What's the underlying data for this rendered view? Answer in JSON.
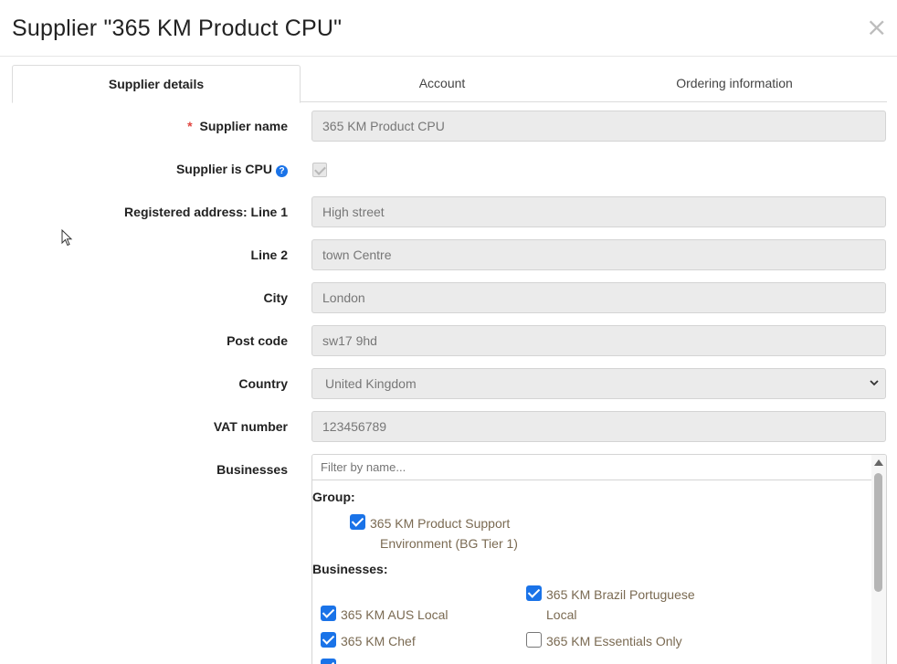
{
  "modal": {
    "title": "Supplier \"365 KM Product CPU\"",
    "close_glyph": "×"
  },
  "tabs": [
    {
      "label": "Supplier details",
      "active": true
    },
    {
      "label": "Account",
      "active": false
    },
    {
      "label": "Ordering information",
      "active": false
    }
  ],
  "form": {
    "supplier_name": {
      "label": "Supplier name",
      "required_mark": "*",
      "value": "365 KM Product CPU"
    },
    "supplier_is_cpu": {
      "label": "Supplier is CPU",
      "help_glyph": "?",
      "checked": true,
      "disabled": true
    },
    "address_line1": {
      "label": "Registered address: Line 1",
      "value": "High street"
    },
    "address_line2": {
      "label": "Line 2",
      "value": "town Centre"
    },
    "city": {
      "label": "City",
      "value": "London"
    },
    "post_code": {
      "label": "Post code",
      "value": "sw17 9hd"
    },
    "country": {
      "label": "Country",
      "value": "United Kingdom"
    },
    "vat_number": {
      "label": "VAT number",
      "value": "123456789"
    },
    "businesses": {
      "label": "Businesses",
      "filter_placeholder": "Filter by name...",
      "group_heading": "Group:",
      "group_item": {
        "line1": "365 KM Product Support",
        "line2": "Environment (BG Tier 1)",
        "checked": true
      },
      "businesses_heading": "Businesses:",
      "items": [
        {
          "line1": "365 KM AUS Local",
          "line2": "",
          "checked": true
        },
        {
          "line1": "365 KM Brazil Portuguese",
          "line2": "Local",
          "checked": true
        },
        {
          "line1": "365 KM Chef",
          "line2": "",
          "checked": true
        },
        {
          "line1": "365 KM Essentials Only",
          "line2": "",
          "checked": false
        }
      ]
    }
  },
  "colors": {
    "accent": "#1a73e8",
    "required": "#e0443f",
    "field_bg": "#ebebeb"
  },
  "icons": {
    "close": "close-icon",
    "help": "help-icon",
    "chevron": "chevron-down-icon",
    "cursor": "mouse-pointer-icon"
  }
}
